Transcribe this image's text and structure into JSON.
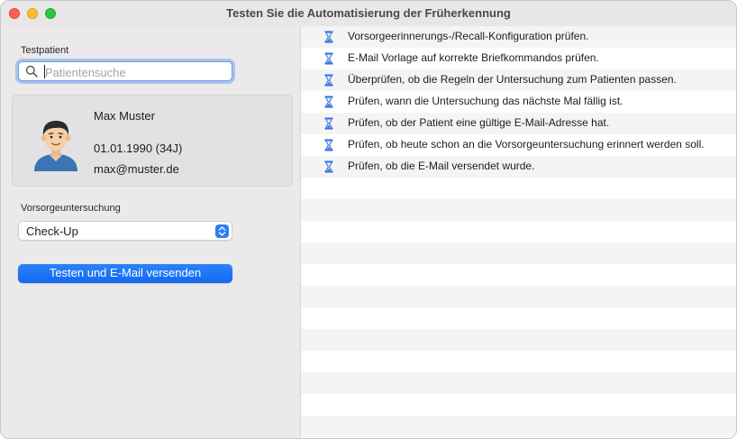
{
  "window": {
    "title": "Testen Sie die Automatisierung der Früherkennung"
  },
  "sidebar": {
    "patient_label": "Testpatient",
    "search": {
      "placeholder": "Patientensuche",
      "value": ""
    },
    "patient": {
      "name": "Max Muster",
      "dob": "01.01.1990 (34J)",
      "email": "max@muster.de"
    },
    "exam_label": "Vorsorgeuntersuchung",
    "exam_select": {
      "value": "Check-Up"
    },
    "test_button": "Testen und E-Mail versenden"
  },
  "checks": [
    {
      "icon": "hourglass-icon",
      "label": "Vorsorgeerinnerungs-/Recall-Konfiguration prüfen."
    },
    {
      "icon": "hourglass-icon",
      "label": "E-Mail Vorlage auf korrekte Briefkommandos prüfen."
    },
    {
      "icon": "hourglass-icon",
      "label": "Überprüfen, ob die Regeln der Untersuchung zum Patienten passen."
    },
    {
      "icon": "hourglass-icon",
      "label": "Prüfen, wann die Untersuchung das nächste Mal fällig ist."
    },
    {
      "icon": "hourglass-icon",
      "label": "Prüfen, ob der Patient eine gültige E-Mail-Adresse hat."
    },
    {
      "icon": "hourglass-icon",
      "label": "Prüfen, ob heute schon an die Vorsorgeuntersuchung erinnert werden soll."
    },
    {
      "icon": "hourglass-icon",
      "label": "Prüfen, ob die E-Mail versendet wurde."
    }
  ],
  "colors": {
    "accent": "#1468f0",
    "focus_ring": "#5892eb",
    "hourglass": "#2f6fd8",
    "row_stripe": "#f4f4f5"
  }
}
